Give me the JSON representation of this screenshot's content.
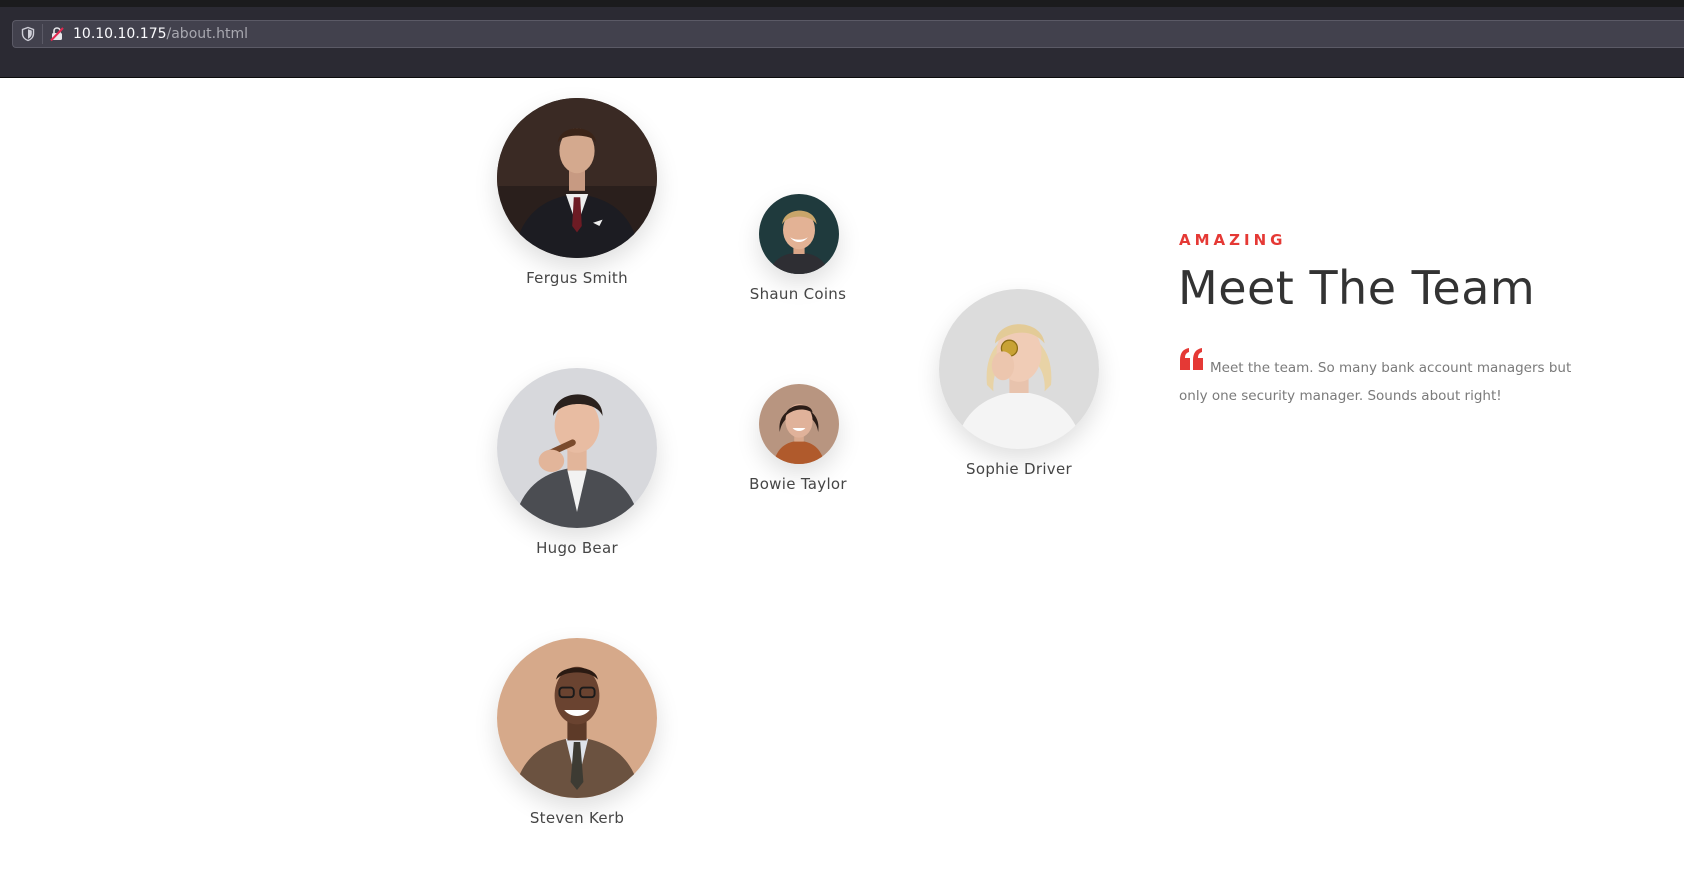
{
  "browser": {
    "url_host": "10.10.10.175",
    "url_path": "/about.html"
  },
  "team": {
    "members": [
      {
        "name": "Fergus Smith"
      },
      {
        "name": "Shaun Coins"
      },
      {
        "name": "Hugo Bear"
      },
      {
        "name": "Bowie Taylor"
      },
      {
        "name": "Sophie Driver"
      },
      {
        "name": "Steven Kerb"
      }
    ]
  },
  "section": {
    "eyebrow": "AMAZING",
    "title": "Meet The Team",
    "description": "Meet the team. So many bank account managers but only one security manager. Sounds about right!"
  },
  "colors": {
    "accent": "#e53935",
    "heading": "#333333",
    "body_text": "#7a7a7a"
  }
}
